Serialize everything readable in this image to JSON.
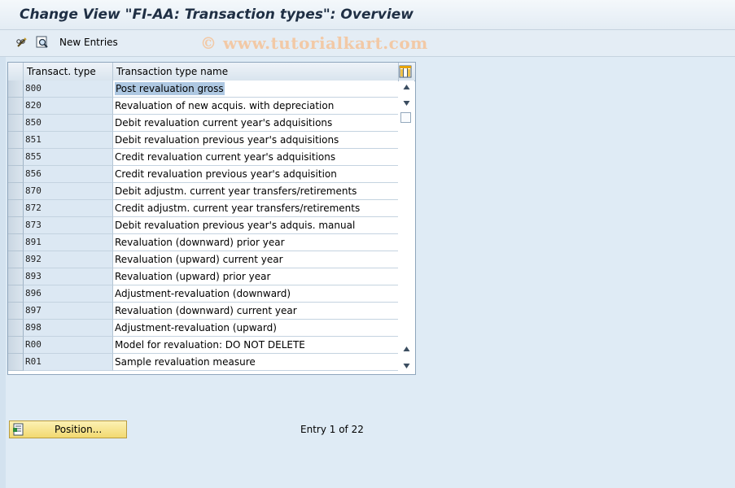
{
  "window": {
    "title": "Change View \"FI-AA: Transaction types\": Overview",
    "watermark": "© www.tutorialkart.com"
  },
  "toolbar": {
    "change_icon": "pencil-glasses-icon",
    "details_icon": "magnifier-icon",
    "new_entries_label": "New Entries"
  },
  "table": {
    "columns": [
      "Transact. type",
      "Transaction type name"
    ],
    "settings_icon": "table-settings-icon",
    "rows": [
      {
        "code": "800",
        "name": "Post revaluation gross"
      },
      {
        "code": "820",
        "name": "Revaluation of new acquis. with depreciation"
      },
      {
        "code": "850",
        "name": "Debit revaluation current year's adquisitions"
      },
      {
        "code": "851",
        "name": "Debit revaluation previous year's adquisitions"
      },
      {
        "code": "855",
        "name": "Credit revaluation current year's adquisitions"
      },
      {
        "code": "856",
        "name": "Credit revaluation previous year's adquisition"
      },
      {
        "code": "870",
        "name": "Debit adjustm. current year transfers/retirements"
      },
      {
        "code": "872",
        "name": "Credit adjustm. current year transfers/retirements"
      },
      {
        "code": "873",
        "name": "Debit revaluation previous year's adquis. manual"
      },
      {
        "code": "891",
        "name": "Revaluation (downward) prior year"
      },
      {
        "code": "892",
        "name": "Revaluation (upward) current year"
      },
      {
        "code": "893",
        "name": "Revaluation (upward) prior year"
      },
      {
        "code": "896",
        "name": "Adjustment-revaluation (downward)"
      },
      {
        "code": "897",
        "name": "Revaluation (downward) current year"
      },
      {
        "code": "898",
        "name": "Adjustment-revaluation (upward)"
      },
      {
        "code": "R00",
        "name": "Model for revaluation:  DO NOT DELETE"
      },
      {
        "code": "R01",
        "name": "Sample revaluation measure"
      }
    ]
  },
  "footer": {
    "position_button": "Position...",
    "entry_status": "Entry 1 of 22"
  },
  "colors": {
    "background": "#dfebf5",
    "key_cell": "#dce8f3",
    "selected_text": "#aec8e2",
    "button": "#f2d970"
  }
}
